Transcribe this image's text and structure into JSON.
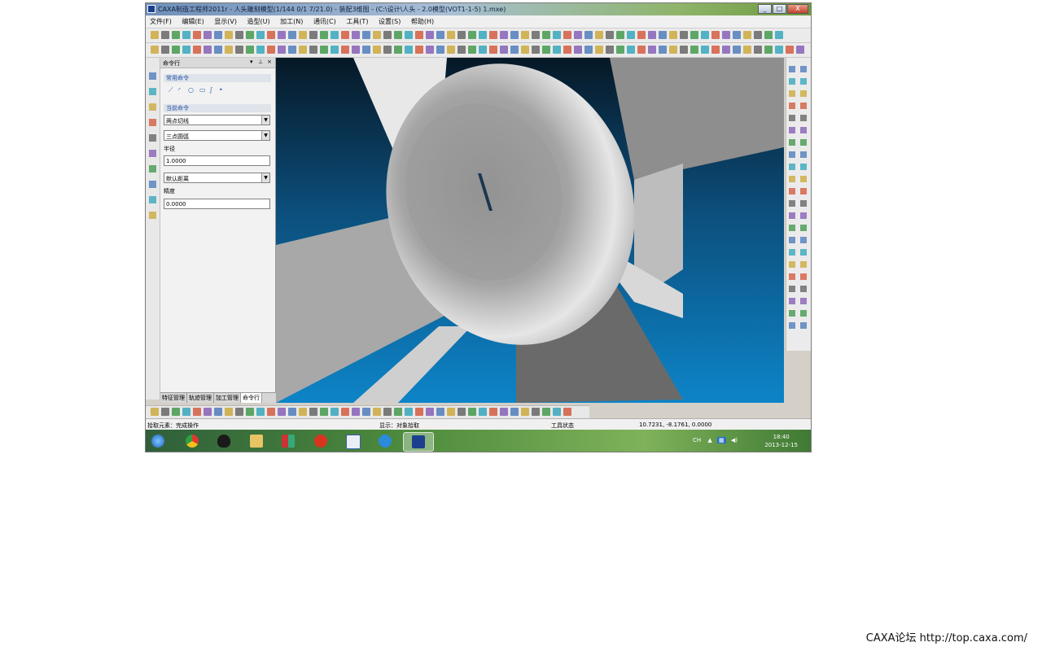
{
  "window": {
    "title": "CAXA制造工程师2011r - 人头雕刻模型(1/144 0/1 7/21.0) - 装配3维图 - (C:\\设计\\人头 - 2.0模型(VOT1-1-5) 1.mxe)",
    "min_label": "_",
    "max_label": "□",
    "close_label": "X"
  },
  "menu": [
    "文件(F)",
    "编辑(E)",
    "显示(V)",
    "造型(U)",
    "加工(N)",
    "通讯(C)",
    "工具(T)",
    "设置(S)",
    "帮助(H)"
  ],
  "panel": {
    "title": "命令行",
    "section1": "常用命令",
    "section2": "当前命令",
    "field1": "两点切线",
    "field2": "三点圆弧",
    "label_radius": "半径",
    "radius_value": "1.0000",
    "field3": "默认距离",
    "label_precision": "精度",
    "precision_value": "0.0000",
    "tabs": [
      "特征管理",
      "轨迹管理",
      "加工管理",
      "命令行"
    ]
  },
  "status": {
    "prompt": "拾取元素：完成操作",
    "mode": "显示：对象拾取",
    "state": "工具状态",
    "coords": "10.7231, -8.1761, 0.0000"
  },
  "taskbar": {
    "tray_text": "CH",
    "time": "18:40",
    "date": "2013-12-15"
  },
  "watermark": "CAXA论坛 http://top.caxa.com/",
  "colors": {
    "viewport_top": "#0a1e30",
    "viewport_bottom": "#0c79bf",
    "model_gray": "#a6a6a6",
    "taskbar_green": "#4e8c3d"
  }
}
